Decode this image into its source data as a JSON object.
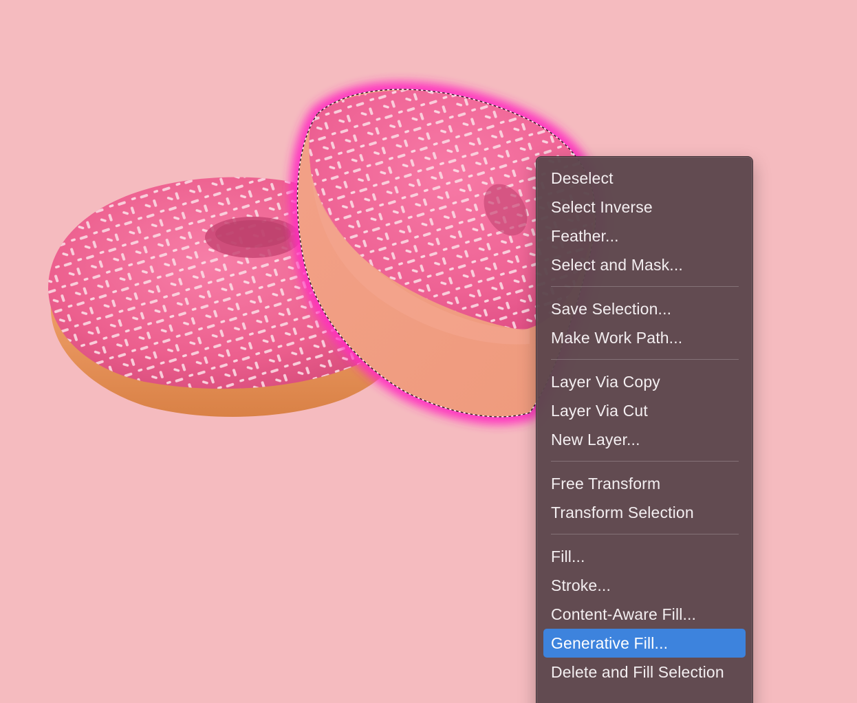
{
  "canvas": {
    "background_color": "#f5bbbf",
    "selection_glow_color": "#ff2fc0",
    "image_subject": [
      "donut-back",
      "donut-front-selected"
    ]
  },
  "context_menu": {
    "groups": [
      {
        "items": [
          {
            "label": "Deselect",
            "icon": "none"
          },
          {
            "label": "Select Inverse",
            "icon": "none"
          },
          {
            "label": "Feather...",
            "icon": "none"
          },
          {
            "label": "Select and Mask...",
            "icon": "none"
          }
        ]
      },
      {
        "items": [
          {
            "label": "Save Selection...",
            "icon": "none"
          },
          {
            "label": "Make Work Path...",
            "icon": "none"
          }
        ]
      },
      {
        "items": [
          {
            "label": "Layer Via Copy",
            "icon": "none"
          },
          {
            "label": "Layer Via Cut",
            "icon": "none"
          },
          {
            "label": "New Layer...",
            "icon": "none"
          }
        ]
      },
      {
        "items": [
          {
            "label": "Free Transform",
            "icon": "none"
          },
          {
            "label": "Transform Selection",
            "icon": "none"
          }
        ]
      },
      {
        "items": [
          {
            "label": "Fill...",
            "icon": "none"
          },
          {
            "label": "Stroke...",
            "icon": "none"
          },
          {
            "label": "Content-Aware Fill...",
            "icon": "none"
          },
          {
            "label": "Generative Fill...",
            "icon": "none",
            "highlighted": true
          },
          {
            "label": "Delete and Fill Selection",
            "icon": "none"
          }
        ]
      }
    ],
    "highlight_color": "#3d83dd"
  }
}
